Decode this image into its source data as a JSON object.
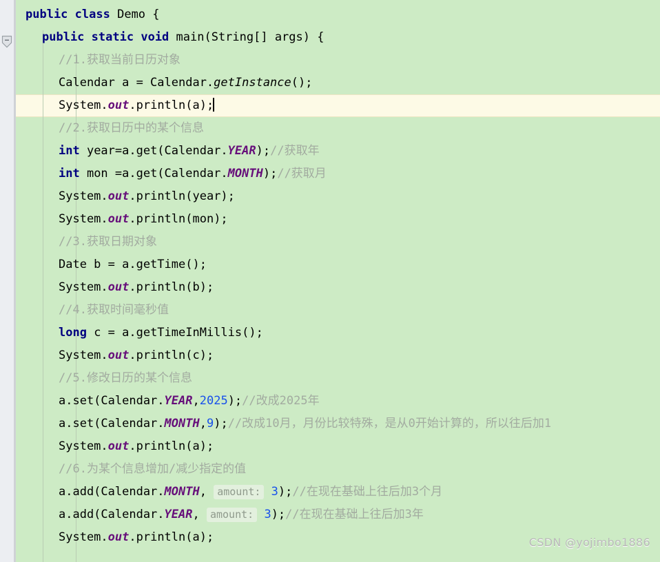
{
  "editor": {
    "language": "java",
    "background_color": "#cdebc5",
    "current_line_color": "#fdfae6",
    "gutter_color": "#eceef2",
    "keyword_color": "#000080",
    "comment_color": "#a2aba0",
    "number_color": "#1750eb",
    "static_field_color": "#660e7a",
    "hint_color": "#8f9a8c",
    "caret_line_index": 4,
    "fold_marker": "−"
  },
  "watermark": {
    "text": "CSDN @yojimbo1886"
  },
  "code": {
    "lines": [
      {
        "index": 0,
        "indent": 0,
        "tokens": [
          {
            "t": "public",
            "c": "kw"
          },
          {
            "t": " ",
            "c": "plain"
          },
          {
            "t": "class",
            "c": "kw"
          },
          {
            "t": " Demo {",
            "c": "plain"
          }
        ]
      },
      {
        "index": 1,
        "indent": 1,
        "tokens": [
          {
            "t": "public",
            "c": "kw"
          },
          {
            "t": " ",
            "c": "plain"
          },
          {
            "t": "static",
            "c": "kw"
          },
          {
            "t": " ",
            "c": "plain"
          },
          {
            "t": "void",
            "c": "kw"
          },
          {
            "t": " main(String[] args) {",
            "c": "plain"
          }
        ]
      },
      {
        "index": 2,
        "indent": 2,
        "tokens": [
          {
            "t": "//1.获取当前日历对象",
            "c": "cmt"
          }
        ]
      },
      {
        "index": 3,
        "indent": 2,
        "tokens": [
          {
            "t": "Calendar a = Calendar.",
            "c": "plain"
          },
          {
            "t": "getInstance",
            "c": "stat"
          },
          {
            "t": "();",
            "c": "plain"
          }
        ]
      },
      {
        "index": 4,
        "indent": 2,
        "tokens": [
          {
            "t": "System.",
            "c": "plain"
          },
          {
            "t": "out",
            "c": "field"
          },
          {
            "t": ".println(a);",
            "c": "plain"
          }
        ]
      },
      {
        "index": 5,
        "indent": 2,
        "tokens": [
          {
            "t": "//2.获取日历中的某个信息",
            "c": "cmt"
          }
        ]
      },
      {
        "index": 6,
        "indent": 2,
        "tokens": [
          {
            "t": "int",
            "c": "kw"
          },
          {
            "t": " year=a.get(Calendar.",
            "c": "plain"
          },
          {
            "t": "YEAR",
            "c": "field"
          },
          {
            "t": ");",
            "c": "plain"
          },
          {
            "t": "//获取年",
            "c": "cmt"
          }
        ]
      },
      {
        "index": 7,
        "indent": 2,
        "tokens": [
          {
            "t": "int",
            "c": "kw"
          },
          {
            "t": " mon =a.get(Calendar.",
            "c": "plain"
          },
          {
            "t": "MONTH",
            "c": "field"
          },
          {
            "t": ");",
            "c": "plain"
          },
          {
            "t": "//获取月",
            "c": "cmt"
          }
        ]
      },
      {
        "index": 8,
        "indent": 2,
        "tokens": [
          {
            "t": "System.",
            "c": "plain"
          },
          {
            "t": "out",
            "c": "field"
          },
          {
            "t": ".println(year);",
            "c": "plain"
          }
        ]
      },
      {
        "index": 9,
        "indent": 2,
        "tokens": [
          {
            "t": "System.",
            "c": "plain"
          },
          {
            "t": "out",
            "c": "field"
          },
          {
            "t": ".println(mon);",
            "c": "plain"
          }
        ]
      },
      {
        "index": 10,
        "indent": 2,
        "tokens": [
          {
            "t": "//3.获取日期对象",
            "c": "cmt"
          }
        ]
      },
      {
        "index": 11,
        "indent": 2,
        "tokens": [
          {
            "t": "Date b = a.getTime();",
            "c": "plain"
          }
        ]
      },
      {
        "index": 12,
        "indent": 2,
        "tokens": [
          {
            "t": "System.",
            "c": "plain"
          },
          {
            "t": "out",
            "c": "field"
          },
          {
            "t": ".println(b);",
            "c": "plain"
          }
        ]
      },
      {
        "index": 13,
        "indent": 2,
        "tokens": [
          {
            "t": "//4.获取时间毫秒值",
            "c": "cmt"
          }
        ]
      },
      {
        "index": 14,
        "indent": 2,
        "tokens": [
          {
            "t": "long",
            "c": "kw"
          },
          {
            "t": " c = a.getTimeInMillis();",
            "c": "plain"
          }
        ]
      },
      {
        "index": 15,
        "indent": 2,
        "tokens": [
          {
            "t": "System.",
            "c": "plain"
          },
          {
            "t": "out",
            "c": "field"
          },
          {
            "t": ".println(c);",
            "c": "plain"
          }
        ]
      },
      {
        "index": 16,
        "indent": 2,
        "tokens": [
          {
            "t": "//5.修改日历的某个信息",
            "c": "cmt"
          }
        ]
      },
      {
        "index": 17,
        "indent": 2,
        "tokens": [
          {
            "t": "a.set(Calendar.",
            "c": "plain"
          },
          {
            "t": "YEAR",
            "c": "field"
          },
          {
            "t": ",",
            "c": "plain"
          },
          {
            "t": "2025",
            "c": "num"
          },
          {
            "t": ");",
            "c": "plain"
          },
          {
            "t": "//改成2025年",
            "c": "cmt"
          }
        ]
      },
      {
        "index": 18,
        "indent": 2,
        "tokens": [
          {
            "t": "a.set(Calendar.",
            "c": "plain"
          },
          {
            "t": "MONTH",
            "c": "field"
          },
          {
            "t": ",",
            "c": "plain"
          },
          {
            "t": "9",
            "c": "num"
          },
          {
            "t": ");",
            "c": "plain"
          },
          {
            "t": "//改成10月，月份比较特殊，是从0开始计算的，所以往后加1",
            "c": "cmt"
          }
        ]
      },
      {
        "index": 19,
        "indent": 2,
        "tokens": [
          {
            "t": "System.",
            "c": "plain"
          },
          {
            "t": "out",
            "c": "field"
          },
          {
            "t": ".println(a);",
            "c": "plain"
          }
        ]
      },
      {
        "index": 20,
        "indent": 2,
        "tokens": [
          {
            "t": "//6.为某个信息增加/减少指定的值",
            "c": "cmt"
          }
        ]
      },
      {
        "index": 21,
        "indent": 2,
        "tokens": [
          {
            "t": "a.add(Calendar.",
            "c": "plain"
          },
          {
            "t": "MONTH",
            "c": "field"
          },
          {
            "t": ", ",
            "c": "plain"
          },
          {
            "t": "amount:",
            "c": "hint"
          },
          {
            "t": " ",
            "c": "plain"
          },
          {
            "t": "3",
            "c": "num"
          },
          {
            "t": ");",
            "c": "plain"
          },
          {
            "t": "//在现在基础上往后加3个月",
            "c": "cmt"
          }
        ]
      },
      {
        "index": 22,
        "indent": 2,
        "tokens": [
          {
            "t": "a.add(Calendar.",
            "c": "plain"
          },
          {
            "t": "YEAR",
            "c": "field"
          },
          {
            "t": ", ",
            "c": "plain"
          },
          {
            "t": "amount:",
            "c": "hint"
          },
          {
            "t": " ",
            "c": "plain"
          },
          {
            "t": "3",
            "c": "num"
          },
          {
            "t": ");",
            "c": "plain"
          },
          {
            "t": "//在现在基础上往后加3年",
            "c": "cmt"
          }
        ]
      },
      {
        "index": 23,
        "indent": 2,
        "tokens": [
          {
            "t": "System.",
            "c": "plain"
          },
          {
            "t": "out",
            "c": "field"
          },
          {
            "t": ".println(a);",
            "c": "plain"
          }
        ]
      }
    ]
  }
}
